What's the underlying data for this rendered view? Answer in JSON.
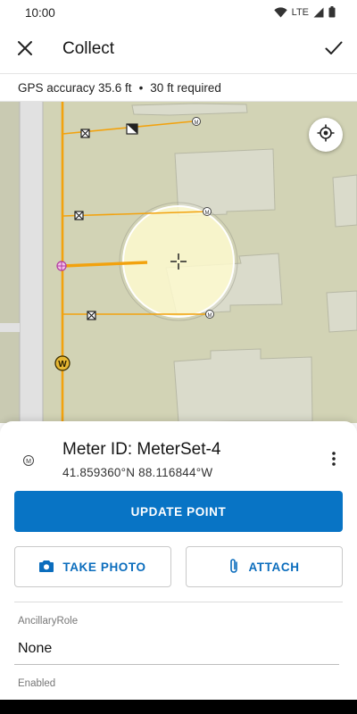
{
  "status_bar": {
    "time": "10:00",
    "network_label": "LTE",
    "icons": [
      "wifi-icon",
      "cellular-signal-icon",
      "battery-icon"
    ]
  },
  "app_bar": {
    "title": "Collect",
    "close_icon": "close-icon",
    "confirm_icon": "checkmark-icon"
  },
  "gps": {
    "accuracy_text": "GPS accuracy 35.6 ft",
    "separator": "•",
    "required_text": "30 ft required"
  },
  "map": {
    "locate_icon": "crosshair-locate-icon",
    "symbols": [
      "meter-symbol-icon",
      "valve-symbol-icon",
      "water-symbol-icon",
      "junction-symbol-icon"
    ],
    "water_label": "W",
    "meter_label": "M"
  },
  "feature": {
    "title": "Meter ID: MeterSet-4",
    "coordinates": "41.859360°N  88.116844°W",
    "icon": "meter-symbol-icon",
    "more_icon": "more-vertical-icon"
  },
  "actions": {
    "update_point": "UPDATE POINT",
    "take_photo": "TAKE PHOTO",
    "attach": "ATTACH"
  },
  "form": {
    "fields": [
      {
        "label": "AncillaryRole",
        "value": "None"
      },
      {
        "label": "Enabled",
        "value": ""
      }
    ]
  },
  "colors": {
    "primary": "#0874c5",
    "map_background": "#d2d3b5",
    "building": "#dadbcb",
    "water_line": "#f2a20e",
    "accuracy_circle": "#fffbcf"
  }
}
